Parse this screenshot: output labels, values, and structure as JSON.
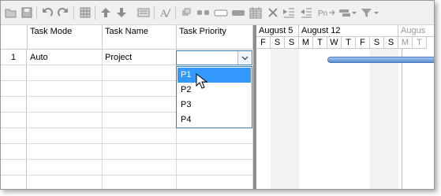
{
  "colors": {
    "selection": "#3399ff",
    "combo_border": "#3c7fb1",
    "task_bar": "#5a8ed2",
    "today_line": "#f5b650",
    "splitter": "#8e8e8e"
  },
  "toolbar": {
    "buttons": [
      {
        "name": "open-icon"
      },
      {
        "name": "save-icon"
      },
      {
        "name": "undo-icon"
      },
      {
        "name": "redo-icon"
      },
      {
        "name": "columns-icon"
      },
      {
        "name": "move-up-icon"
      },
      {
        "name": "move-down-icon"
      },
      {
        "name": "view-icon"
      },
      {
        "name": "font-icon"
      },
      {
        "name": "link-icon"
      },
      {
        "name": "unlink-icon"
      },
      {
        "name": "bar-icon"
      },
      {
        "name": "summary-icon"
      },
      {
        "name": "calendar-icon"
      },
      {
        "name": "delete-icon"
      },
      {
        "name": "indent-icon"
      },
      {
        "name": "outdent-icon"
      },
      {
        "name": "predecessor-icon"
      },
      {
        "name": "layout-dropdown-icon"
      },
      {
        "name": "filter-dropdown-icon"
      }
    ]
  },
  "grid": {
    "columns": [
      "Task Mode",
      "Task Name",
      "Task Priority"
    ],
    "rows": [
      {
        "num": "1",
        "mode": "Auto",
        "name": "Project",
        "priority": ""
      }
    ]
  },
  "priority_dropdown": {
    "options": [
      "P1",
      "P2",
      "P3",
      "P4"
    ],
    "selected": "P1"
  },
  "timeline": {
    "weeks": [
      "August 5",
      "August 12",
      "Augus"
    ],
    "days": [
      "F",
      "S",
      "S",
      "M",
      "T",
      "W",
      "T",
      "F",
      "S",
      "S",
      "M",
      "T"
    ]
  }
}
